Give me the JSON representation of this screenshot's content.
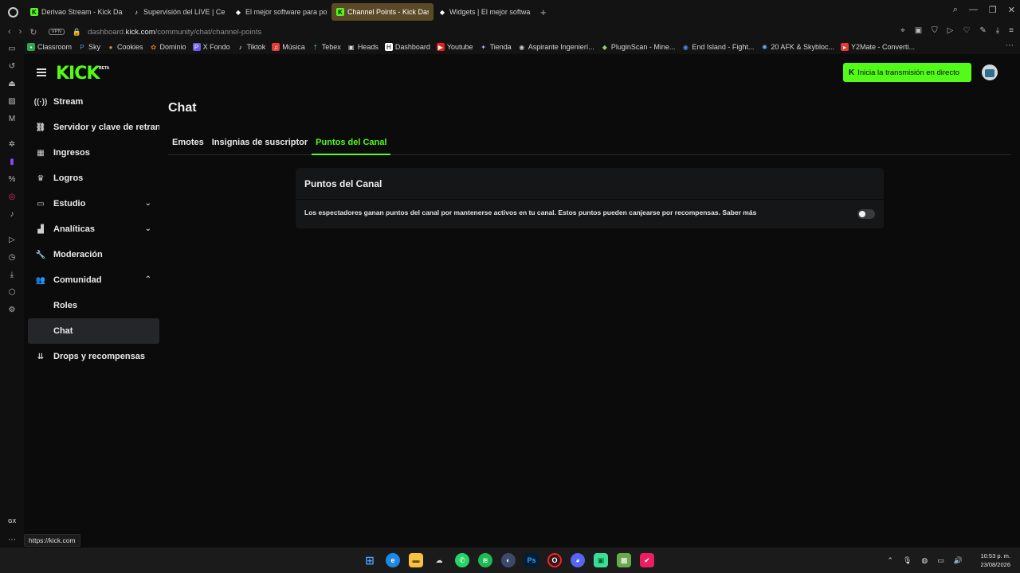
{
  "browser": {
    "tabs": [
      {
        "label": "Derivao Stream - Kick Dash",
        "icon": "kick"
      },
      {
        "label": "Supervisión del LIVE | Cen",
        "icon": "tiktok"
      },
      {
        "label": "El mejor software para pot",
        "icon": "generic"
      },
      {
        "label": "Channel Points - Kick Das",
        "icon": "kick",
        "active": true
      },
      {
        "label": "Widgets | El mejor software",
        "icon": "generic"
      }
    ],
    "new_tab": "+",
    "vpn": "VPN",
    "url_prefix": "dashboard.",
    "url_domain": "kick.com",
    "url_path": "/community/chat/channel-points",
    "bookmarks": [
      "Classroom",
      "Sky",
      "Cookies",
      "Dominio",
      "X Fondo",
      "Tiktok",
      "Música",
      "Tebex",
      "Heads",
      "Dashboard",
      "Youtube",
      "Tienda",
      "Aspirante Ingenierí...",
      "PluginScan - Mine...",
      "End Island - Fight...",
      "20 AFK & Skybloc...",
      "Y2Mate - Converti..."
    ]
  },
  "header": {
    "logo": "KICK",
    "beta": "BETA",
    "go_live": "Inicia la transmisión en directo",
    "go_live_icon": "K"
  },
  "sidebar": {
    "items": [
      {
        "label": "Stream",
        "icon": "((·))"
      },
      {
        "label": "Servidor y clave de retransmisión",
        "icon": "⛓"
      },
      {
        "label": "Ingresos",
        "icon": "▦"
      },
      {
        "label": "Logros",
        "icon": "♛"
      },
      {
        "label": "Estudio",
        "icon": "▭",
        "chevron": "⌄"
      },
      {
        "label": "Analíticas",
        "icon": "▟",
        "chevron": "⌄"
      },
      {
        "label": "Moderación",
        "icon": "🔧"
      },
      {
        "label": "Comunidad",
        "icon": "👥",
        "chevron": "⌃"
      },
      {
        "label": "Roles",
        "sub": true
      },
      {
        "label": "Chat",
        "sub": true,
        "selected": true
      },
      {
        "label": "Drops y recompensas",
        "icon": "⇊"
      }
    ]
  },
  "main": {
    "title": "Chat",
    "tabs": [
      {
        "label": "Emotes"
      },
      {
        "label": "Insignias de suscriptor"
      },
      {
        "label": "Puntos del Canal",
        "active": true
      }
    ],
    "card": {
      "title": "Puntos del Canal",
      "description": "Los espectadores ganan puntos del canal por mantenerse activos en tu canal. Estos puntos pueden canjearse por recompensas. Saber más",
      "toggle_on": false
    }
  },
  "status_url": "https://kick.com",
  "gx": "GX",
  "clock": {
    "time": "10:53 p. m.",
    "date": "23/08/2026"
  },
  "accent": "#53fc18"
}
